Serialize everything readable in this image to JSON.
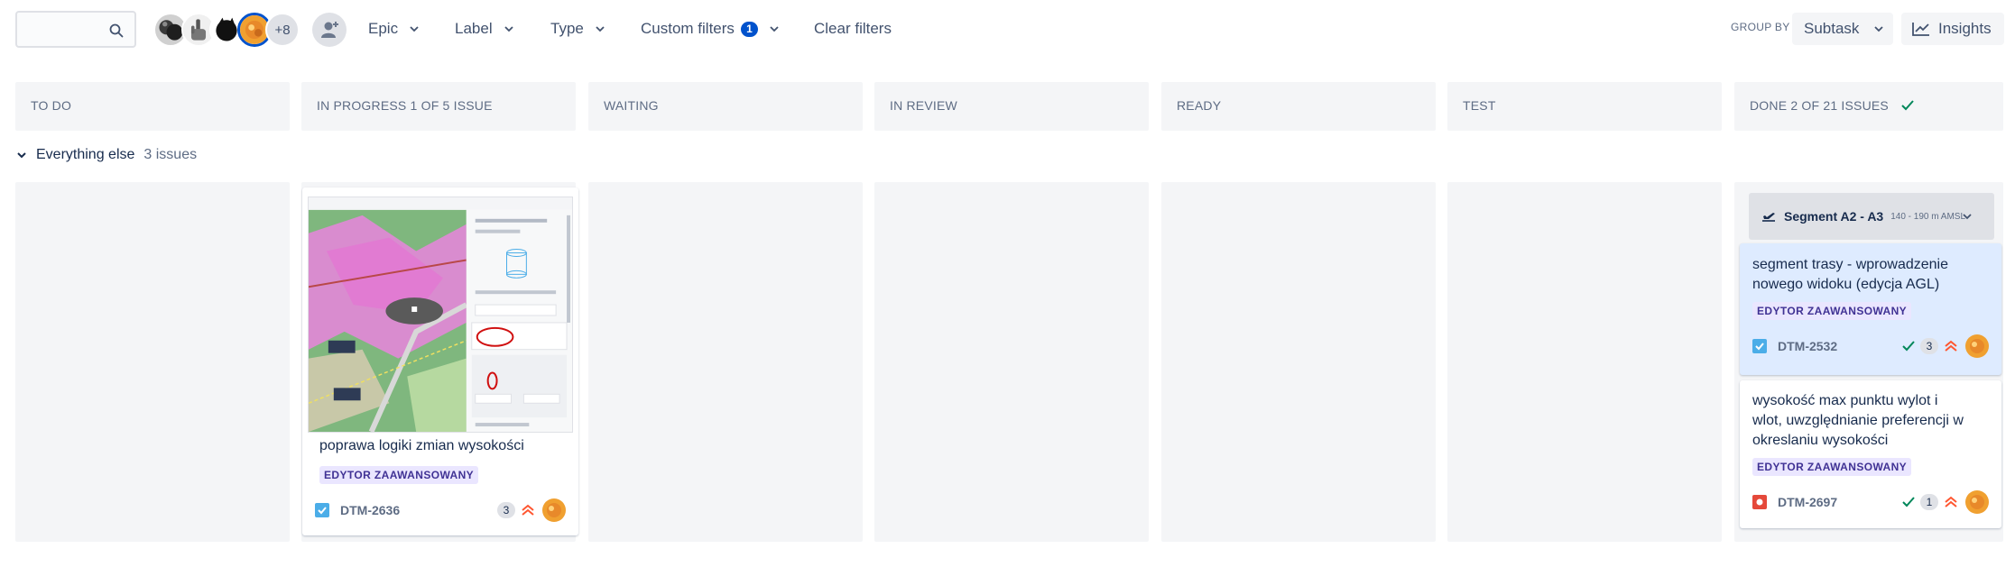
{
  "toolbar": {
    "search": {
      "value": "",
      "placeholder": ""
    },
    "avatars_more": "+8",
    "filters": [
      {
        "label": "Epic"
      },
      {
        "label": "Label"
      },
      {
        "label": "Type"
      },
      {
        "label": "Custom filters",
        "count": "1"
      },
      {
        "label": "Clear filters"
      }
    ],
    "group_by_label": "GROUP BY",
    "group_by_value": "Subtask",
    "insights_label": "Insights"
  },
  "columns": [
    {
      "title": "TO DO"
    },
    {
      "title": "IN PROGRESS 1 OF 5 ISSUE"
    },
    {
      "title": "WAITING"
    },
    {
      "title": "IN REVIEW"
    },
    {
      "title": "READY"
    },
    {
      "title": "TEST"
    },
    {
      "title": "DONE 2 OF 21 ISSUES"
    }
  ],
  "swimlane": {
    "title": "Everything else",
    "count": "3 issues"
  },
  "cards": {
    "in_progress": {
      "title": "poprawa logiki zmian wysokości",
      "epic": "EDYTOR ZAAWANSOWANY",
      "key": "DTM-2636",
      "estimate": "3",
      "type_icon": "task-checkbox-icon",
      "priority_icon": "priority-high-icon"
    },
    "done_parent": {
      "name": "Segment A2 - A3",
      "altitude": "140 - 190 m AMSL",
      "icon": "plane-takeoff-icon"
    },
    "done_1": {
      "title": "segment trasy - wprowadzenie nowego widoku (edycja AGL)",
      "epic": "EDYTOR ZAAWANSOWANY",
      "key": "DTM-2532",
      "estimate": "3",
      "type_icon": "task-checkbox-icon"
    },
    "done_2": {
      "title": "wysokość max punktu wylot i wlot, uwzględnianie preferencji w okreslaniu wysokości",
      "epic": "EDYTOR ZAAWANSOWANY",
      "key": "DTM-2697",
      "estimate": "1",
      "type_icon": "bug-icon"
    }
  },
  "colors": {
    "column_bg": "#f4f5f7",
    "accent": "#0052cc",
    "epic_bg": "#eae6ff",
    "epic_text": "#403294",
    "task_blue": "#4bade8",
    "bug_red": "#e5493a",
    "done_green": "#00875a",
    "priority": "#ff5630",
    "selected_card": "#deebff"
  }
}
